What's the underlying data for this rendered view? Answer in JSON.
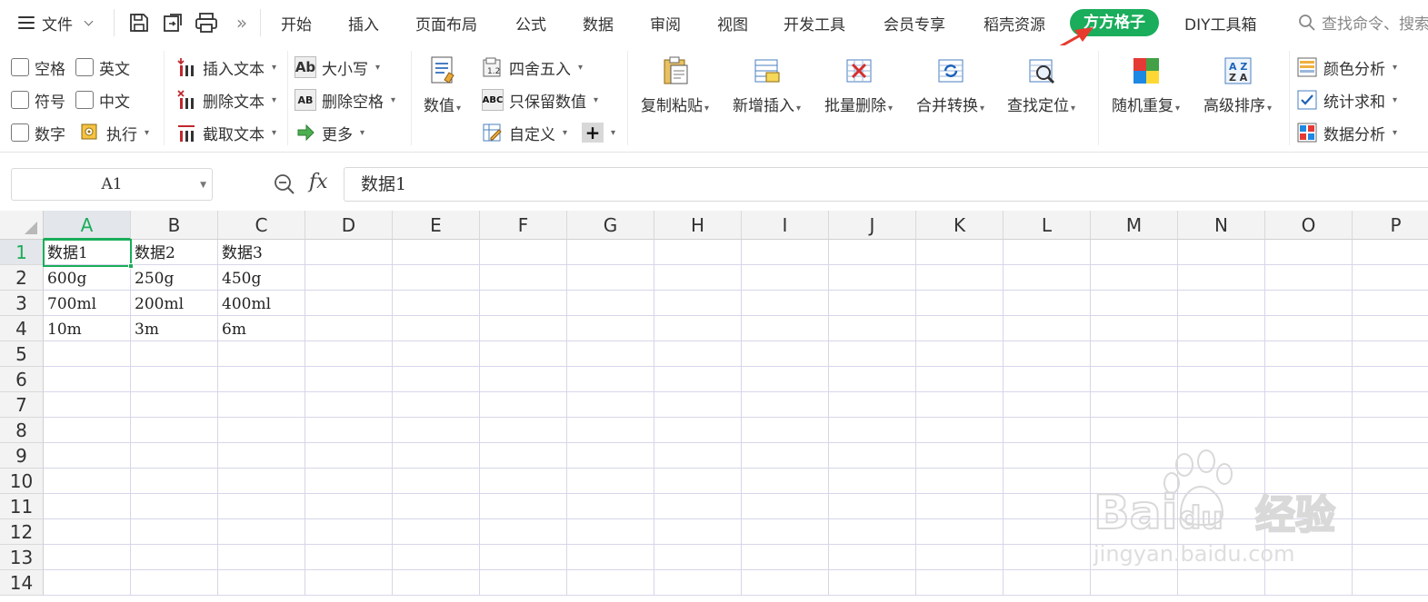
{
  "menubar": {
    "file_label": "文件",
    "tabs": [
      "开始",
      "插入",
      "页面布局",
      "公式",
      "数据",
      "审阅",
      "视图",
      "开发工具",
      "会员专享",
      "稻壳资源",
      "方方格子",
      "DIY工具箱"
    ],
    "active_tab": "方方格子",
    "search_label": "查找命令、搜索"
  },
  "ribbon": {
    "checkboxes": [
      "空格",
      "英文",
      "符号",
      "中文",
      "数字"
    ],
    "execute": "执行",
    "text_tools": [
      "插入文本",
      "删除文本",
      "截取文本"
    ],
    "case_tools": [
      "大小写",
      "删除空格",
      "更多"
    ],
    "numeric": "数值",
    "number_tools": [
      "四舍五入",
      "只保留数值",
      "自定义"
    ],
    "big_buttons": [
      "复制粘贴",
      "新增插入",
      "批量删除",
      "合并转换",
      "查找定位",
      "随机重复",
      "高级排序"
    ],
    "analysis_tools": [
      "颜色分析",
      "统计求和",
      "数据分析"
    ]
  },
  "formula_bar": {
    "name_box": "A1",
    "fx_label": "fx",
    "formula": "数据1"
  },
  "sheet": {
    "columns": [
      "A",
      "B",
      "C",
      "D",
      "E",
      "F",
      "G",
      "H",
      "I",
      "J",
      "K",
      "L",
      "M",
      "N",
      "O",
      "P"
    ],
    "rows": [
      "1",
      "2",
      "3",
      "4",
      "5",
      "6",
      "7",
      "8",
      "9",
      "10",
      "11",
      "12",
      "13",
      "14"
    ],
    "cells": [
      [
        "数据1",
        "数据2",
        "数据3"
      ],
      [
        "600g",
        "250g",
        "450g"
      ],
      [
        "700ml",
        "200ml",
        "400ml"
      ],
      [
        "10m",
        "3m",
        "6m"
      ]
    ],
    "selected_cell": "A1"
  },
  "watermark": {
    "brand": "Bai",
    "brand2": "du",
    "cn": "经验",
    "url": "jingyan.baidu.com"
  },
  "colors": {
    "accent": "#1aad5b",
    "annotation_arrow": "#e8392d",
    "header_bg": "#f3f3f3",
    "gridline": "#d6d6ea"
  }
}
